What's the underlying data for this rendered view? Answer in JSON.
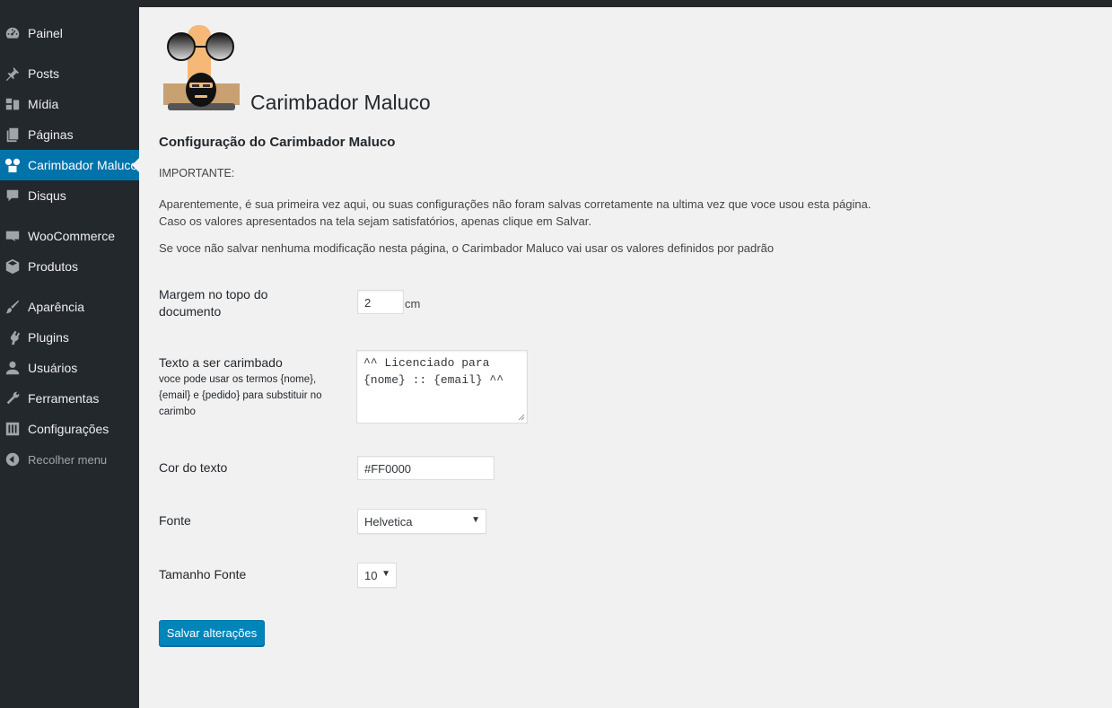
{
  "sidebar": {
    "items": [
      {
        "label": "Painel",
        "icon": "dashboard-icon"
      },
      {
        "label": "Posts",
        "icon": "pushpin-icon"
      },
      {
        "label": "Mídia",
        "icon": "media-icon"
      },
      {
        "label": "Páginas",
        "icon": "pages-icon"
      },
      {
        "label": "Carimbador Maluco",
        "icon": "carimbador-icon",
        "current": true
      },
      {
        "label": "Disqus",
        "icon": "comment-icon"
      },
      {
        "label": "WooCommerce",
        "icon": "woo-icon"
      },
      {
        "label": "Produtos",
        "icon": "box-icon"
      },
      {
        "label": "Aparência",
        "icon": "brush-icon"
      },
      {
        "label": "Plugins",
        "icon": "plugin-icon"
      },
      {
        "label": "Usuários",
        "icon": "user-icon"
      },
      {
        "label": "Ferramentas",
        "icon": "wrench-icon"
      },
      {
        "label": "Configurações",
        "icon": "settings-icon"
      },
      {
        "label": "Recolher menu",
        "icon": "collapse-icon"
      }
    ],
    "colors": {
      "background": "#23282d",
      "current": "#0073aa"
    }
  },
  "header": {
    "plugin_title": "Carimbador Maluco",
    "logo_icon": "carimbador-logo"
  },
  "main": {
    "section_title": "Configuração do Carimbador Maluco",
    "important_label": "IMPORTANTE:",
    "paragraph1_line1": "Aparentemente, é sua primeira vez aqui, ou suas configurações não foram salvas corretamente na ultima vez que voce usou esta página.",
    "paragraph1_line2": "Caso os valores apresentados na tela sejam satisfatórios, apenas clique em Salvar.",
    "paragraph2": "Se voce não salvar nenhuma modificação nesta página, o Carimbador Maluco vai usar os valores definidos por padrão",
    "fields": {
      "margin": {
        "label_line1": "Margem no topo do",
        "label_line2": "documento",
        "value": "2",
        "unit": "cm"
      },
      "text": {
        "label": "Texto a ser carimbado",
        "desc_line1": "voce pode usar os termos {nome},",
        "desc_line2": "{email} e {pedido} para substituir no",
        "desc_line3": "carimbo",
        "value_line1": "^^ Licenciado para",
        "value_line2": "{nome} :: {email} ^^"
      },
      "color": {
        "label": "Cor do texto",
        "value": "#FF0000"
      },
      "font": {
        "label": "Fonte",
        "value": "Helvetica"
      },
      "font_size": {
        "label": "Tamanho Fonte",
        "value": "10"
      }
    },
    "save_label": "Salvar alterações",
    "accent_color": "#0085ba"
  }
}
